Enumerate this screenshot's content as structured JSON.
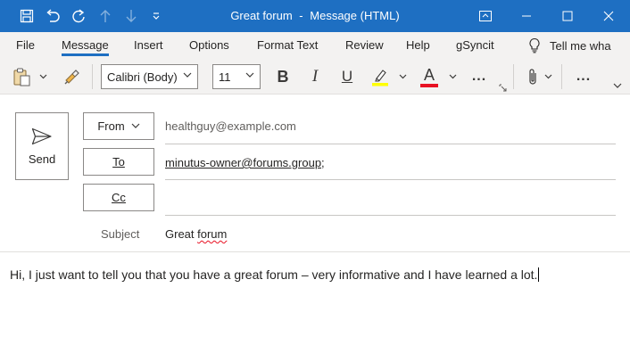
{
  "window": {
    "title": "Great forum",
    "separator": "-",
    "type": "Message (HTML)"
  },
  "menu": {
    "tabs": [
      {
        "label": "File"
      },
      {
        "label": "Message"
      },
      {
        "label": "Insert"
      },
      {
        "label": "Options"
      },
      {
        "label": "Format Text"
      },
      {
        "label": "Review"
      },
      {
        "label": "Help"
      },
      {
        "label": "gSyncit"
      }
    ],
    "active_tab": "Message",
    "tell_me": "Tell me wha"
  },
  "ribbon": {
    "font_name": "Calibri (Body)",
    "font_size": "11",
    "bold": "B",
    "italic": "I",
    "underline": "U",
    "font_color": "A",
    "more": "...",
    "highlight_color": "#ffff00",
    "font_color_bar": "#e81123"
  },
  "compose": {
    "send_label": "Send",
    "from_label": "From",
    "from_value": "healthguy@example.com",
    "to_label": "To",
    "to_value": "minutus-owner@forums.group",
    "to_suffix": ";",
    "cc_label": "Cc",
    "cc_value": "",
    "subject_label": "Subject",
    "subject_word1": "Great",
    "subject_word2": "forum"
  },
  "body": {
    "text": "Hi, I just want to tell you that you have a great forum – very informative and I have learned a lot."
  },
  "colors": {
    "titlebar": "#1e6fc2",
    "accent": "#1e6fc2"
  }
}
